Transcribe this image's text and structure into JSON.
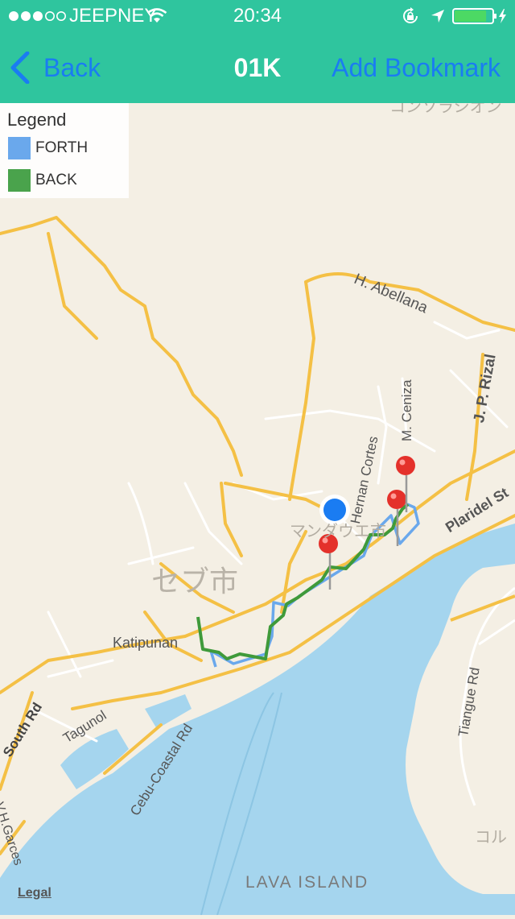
{
  "status_bar": {
    "carrier": "JEEPNEY",
    "time": "20:34",
    "signal_bars_filled": 3,
    "signal_bars_total": 5,
    "battery_level": 0.85
  },
  "nav": {
    "back_label": "Back",
    "title": "01K",
    "bookmark_label": "Add Bookmark"
  },
  "legend": {
    "title": "Legend",
    "items": [
      {
        "label": "FORTH",
        "color": "#6aa8ec"
      },
      {
        "label": "BACK",
        "color": "#4aa34c"
      }
    ]
  },
  "map_labels": {
    "city": "セブ市",
    "district": "マンダウエ市",
    "top_right": "コンソラシオン",
    "bottom_right": "コル",
    "h_abellana": "H. Abellana",
    "m_ceniza": "M. Ceniza",
    "cortes": "Hernan Cortes",
    "jp_rizal": "J. P. Rizal",
    "plaridel": "Plaridel St",
    "katipunan": "Katipunan",
    "tagunol": "Tagunol",
    "cebu_coastal": "Cebu-Coastal Rd",
    "south_rd": "South Rd",
    "vh_garces": "V.H.Garces",
    "tiangue": "Tiangue Rd",
    "lava_island": "LAVA ISLAND",
    "legal": "Legal"
  },
  "colors": {
    "nav_bg": "#2fc59e",
    "accent": "#1a7cf2",
    "land": "#f4efe4",
    "water": "#a5d5ee",
    "major_road": "#f4c045",
    "route_forth": "#6aa8ec",
    "route_back": "#3f9a3a",
    "user_dot": "#1a7cf2",
    "pin": "#e4312b"
  }
}
